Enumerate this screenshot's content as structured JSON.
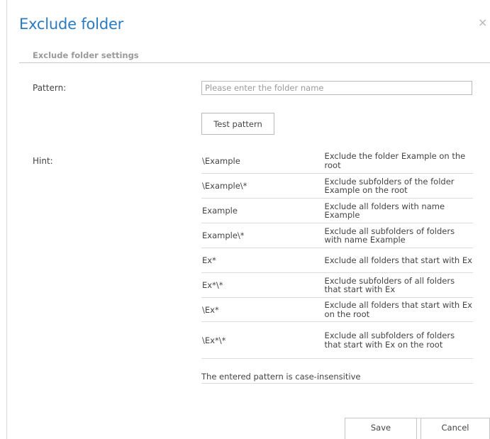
{
  "dialog": {
    "title": "Exclude folder",
    "close_symbol": "×",
    "section_header": "Exclude folder settings"
  },
  "form": {
    "pattern_label": "Pattern:",
    "pattern_value": "",
    "pattern_placeholder": "Please enter the folder name",
    "test_button_label": "Test pattern",
    "hint_label": "Hint:",
    "hints": [
      {
        "pattern": "\\Example",
        "description": "Exclude the folder Example on the root"
      },
      {
        "pattern": "\\Example\\*",
        "description": "Exclude subfolders of the folder Example on the root"
      },
      {
        "pattern": "Example",
        "description": "Exclude all folders with name Example"
      },
      {
        "pattern": "Example\\*",
        "description": "Exclude all subfolders of folders with name Example"
      },
      {
        "pattern": "Ex*",
        "description": "Exclude all folders that start with Ex"
      },
      {
        "pattern": "Ex*\\*",
        "description": "Exclude subfolders of all folders that start with Ex"
      },
      {
        "pattern": "\\Ex*",
        "description": "Exclude all folders that start with Ex on the root"
      },
      {
        "pattern": "\\Ex*\\*",
        "description": "Exclude all subfolders of folders that start with Ex on the root"
      }
    ],
    "case_note": "The entered pattern is case-insensitive"
  },
  "footer": {
    "save_label": "Save",
    "cancel_label": "Cancel"
  },
  "colors": {
    "title": "#2b7bc0",
    "section_header": "#9a9a9a",
    "text": "#444444",
    "border": "#b9b9b9"
  },
  "icons": {
    "close": "close-icon"
  }
}
